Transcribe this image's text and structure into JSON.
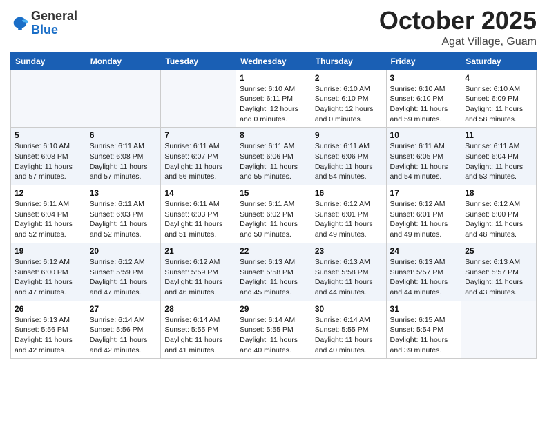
{
  "logo": {
    "general": "General",
    "blue": "Blue"
  },
  "header": {
    "month": "October 2025",
    "location": "Agat Village, Guam"
  },
  "weekdays": [
    "Sunday",
    "Monday",
    "Tuesday",
    "Wednesday",
    "Thursday",
    "Friday",
    "Saturday"
  ],
  "weeks": [
    [
      {
        "day": "",
        "info": ""
      },
      {
        "day": "",
        "info": ""
      },
      {
        "day": "",
        "info": ""
      },
      {
        "day": "1",
        "info": "Sunrise: 6:10 AM\nSunset: 6:11 PM\nDaylight: 12 hours\nand 0 minutes."
      },
      {
        "day": "2",
        "info": "Sunrise: 6:10 AM\nSunset: 6:10 PM\nDaylight: 12 hours\nand 0 minutes."
      },
      {
        "day": "3",
        "info": "Sunrise: 6:10 AM\nSunset: 6:10 PM\nDaylight: 11 hours\nand 59 minutes."
      },
      {
        "day": "4",
        "info": "Sunrise: 6:10 AM\nSunset: 6:09 PM\nDaylight: 11 hours\nand 58 minutes."
      }
    ],
    [
      {
        "day": "5",
        "info": "Sunrise: 6:10 AM\nSunset: 6:08 PM\nDaylight: 11 hours\nand 57 minutes."
      },
      {
        "day": "6",
        "info": "Sunrise: 6:11 AM\nSunset: 6:08 PM\nDaylight: 11 hours\nand 57 minutes."
      },
      {
        "day": "7",
        "info": "Sunrise: 6:11 AM\nSunset: 6:07 PM\nDaylight: 11 hours\nand 56 minutes."
      },
      {
        "day": "8",
        "info": "Sunrise: 6:11 AM\nSunset: 6:06 PM\nDaylight: 11 hours\nand 55 minutes."
      },
      {
        "day": "9",
        "info": "Sunrise: 6:11 AM\nSunset: 6:06 PM\nDaylight: 11 hours\nand 54 minutes."
      },
      {
        "day": "10",
        "info": "Sunrise: 6:11 AM\nSunset: 6:05 PM\nDaylight: 11 hours\nand 54 minutes."
      },
      {
        "day": "11",
        "info": "Sunrise: 6:11 AM\nSunset: 6:04 PM\nDaylight: 11 hours\nand 53 minutes."
      }
    ],
    [
      {
        "day": "12",
        "info": "Sunrise: 6:11 AM\nSunset: 6:04 PM\nDaylight: 11 hours\nand 52 minutes."
      },
      {
        "day": "13",
        "info": "Sunrise: 6:11 AM\nSunset: 6:03 PM\nDaylight: 11 hours\nand 52 minutes."
      },
      {
        "day": "14",
        "info": "Sunrise: 6:11 AM\nSunset: 6:03 PM\nDaylight: 11 hours\nand 51 minutes."
      },
      {
        "day": "15",
        "info": "Sunrise: 6:11 AM\nSunset: 6:02 PM\nDaylight: 11 hours\nand 50 minutes."
      },
      {
        "day": "16",
        "info": "Sunrise: 6:12 AM\nSunset: 6:01 PM\nDaylight: 11 hours\nand 49 minutes."
      },
      {
        "day": "17",
        "info": "Sunrise: 6:12 AM\nSunset: 6:01 PM\nDaylight: 11 hours\nand 49 minutes."
      },
      {
        "day": "18",
        "info": "Sunrise: 6:12 AM\nSunset: 6:00 PM\nDaylight: 11 hours\nand 48 minutes."
      }
    ],
    [
      {
        "day": "19",
        "info": "Sunrise: 6:12 AM\nSunset: 6:00 PM\nDaylight: 11 hours\nand 47 minutes."
      },
      {
        "day": "20",
        "info": "Sunrise: 6:12 AM\nSunset: 5:59 PM\nDaylight: 11 hours\nand 47 minutes."
      },
      {
        "day": "21",
        "info": "Sunrise: 6:12 AM\nSunset: 5:59 PM\nDaylight: 11 hours\nand 46 minutes."
      },
      {
        "day": "22",
        "info": "Sunrise: 6:13 AM\nSunset: 5:58 PM\nDaylight: 11 hours\nand 45 minutes."
      },
      {
        "day": "23",
        "info": "Sunrise: 6:13 AM\nSunset: 5:58 PM\nDaylight: 11 hours\nand 44 minutes."
      },
      {
        "day": "24",
        "info": "Sunrise: 6:13 AM\nSunset: 5:57 PM\nDaylight: 11 hours\nand 44 minutes."
      },
      {
        "day": "25",
        "info": "Sunrise: 6:13 AM\nSunset: 5:57 PM\nDaylight: 11 hours\nand 43 minutes."
      }
    ],
    [
      {
        "day": "26",
        "info": "Sunrise: 6:13 AM\nSunset: 5:56 PM\nDaylight: 11 hours\nand 42 minutes."
      },
      {
        "day": "27",
        "info": "Sunrise: 6:14 AM\nSunset: 5:56 PM\nDaylight: 11 hours\nand 42 minutes."
      },
      {
        "day": "28",
        "info": "Sunrise: 6:14 AM\nSunset: 5:55 PM\nDaylight: 11 hours\nand 41 minutes."
      },
      {
        "day": "29",
        "info": "Sunrise: 6:14 AM\nSunset: 5:55 PM\nDaylight: 11 hours\nand 40 minutes."
      },
      {
        "day": "30",
        "info": "Sunrise: 6:14 AM\nSunset: 5:55 PM\nDaylight: 11 hours\nand 40 minutes."
      },
      {
        "day": "31",
        "info": "Sunrise: 6:15 AM\nSunset: 5:54 PM\nDaylight: 11 hours\nand 39 minutes."
      },
      {
        "day": "",
        "info": ""
      }
    ]
  ]
}
